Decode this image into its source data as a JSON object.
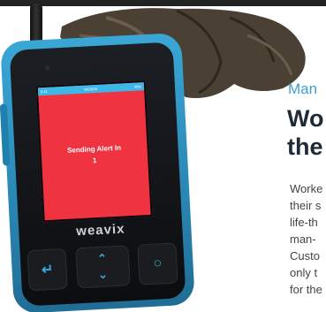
{
  "device": {
    "status_left": "9:41",
    "status_center": "WEAVIX",
    "status_right": "45%",
    "alert_line1": "Sending Alert In",
    "alert_line2": "1",
    "brand": "weavix",
    "keys": [
      "↵",
      "⌃",
      "⌄",
      "○"
    ]
  },
  "article": {
    "kicker": "Man",
    "headline_line1": "Wo",
    "headline_line2": "the",
    "body_lines": [
      "Worke",
      "their s",
      "life-th",
      "man-",
      "Custo",
      "only t",
      "for the"
    ]
  },
  "colors": {
    "accent": "#3f9fd0",
    "alert_red": "#ef3340",
    "device_blue": "#2a86b3",
    "headline": "#1e2a36"
  }
}
